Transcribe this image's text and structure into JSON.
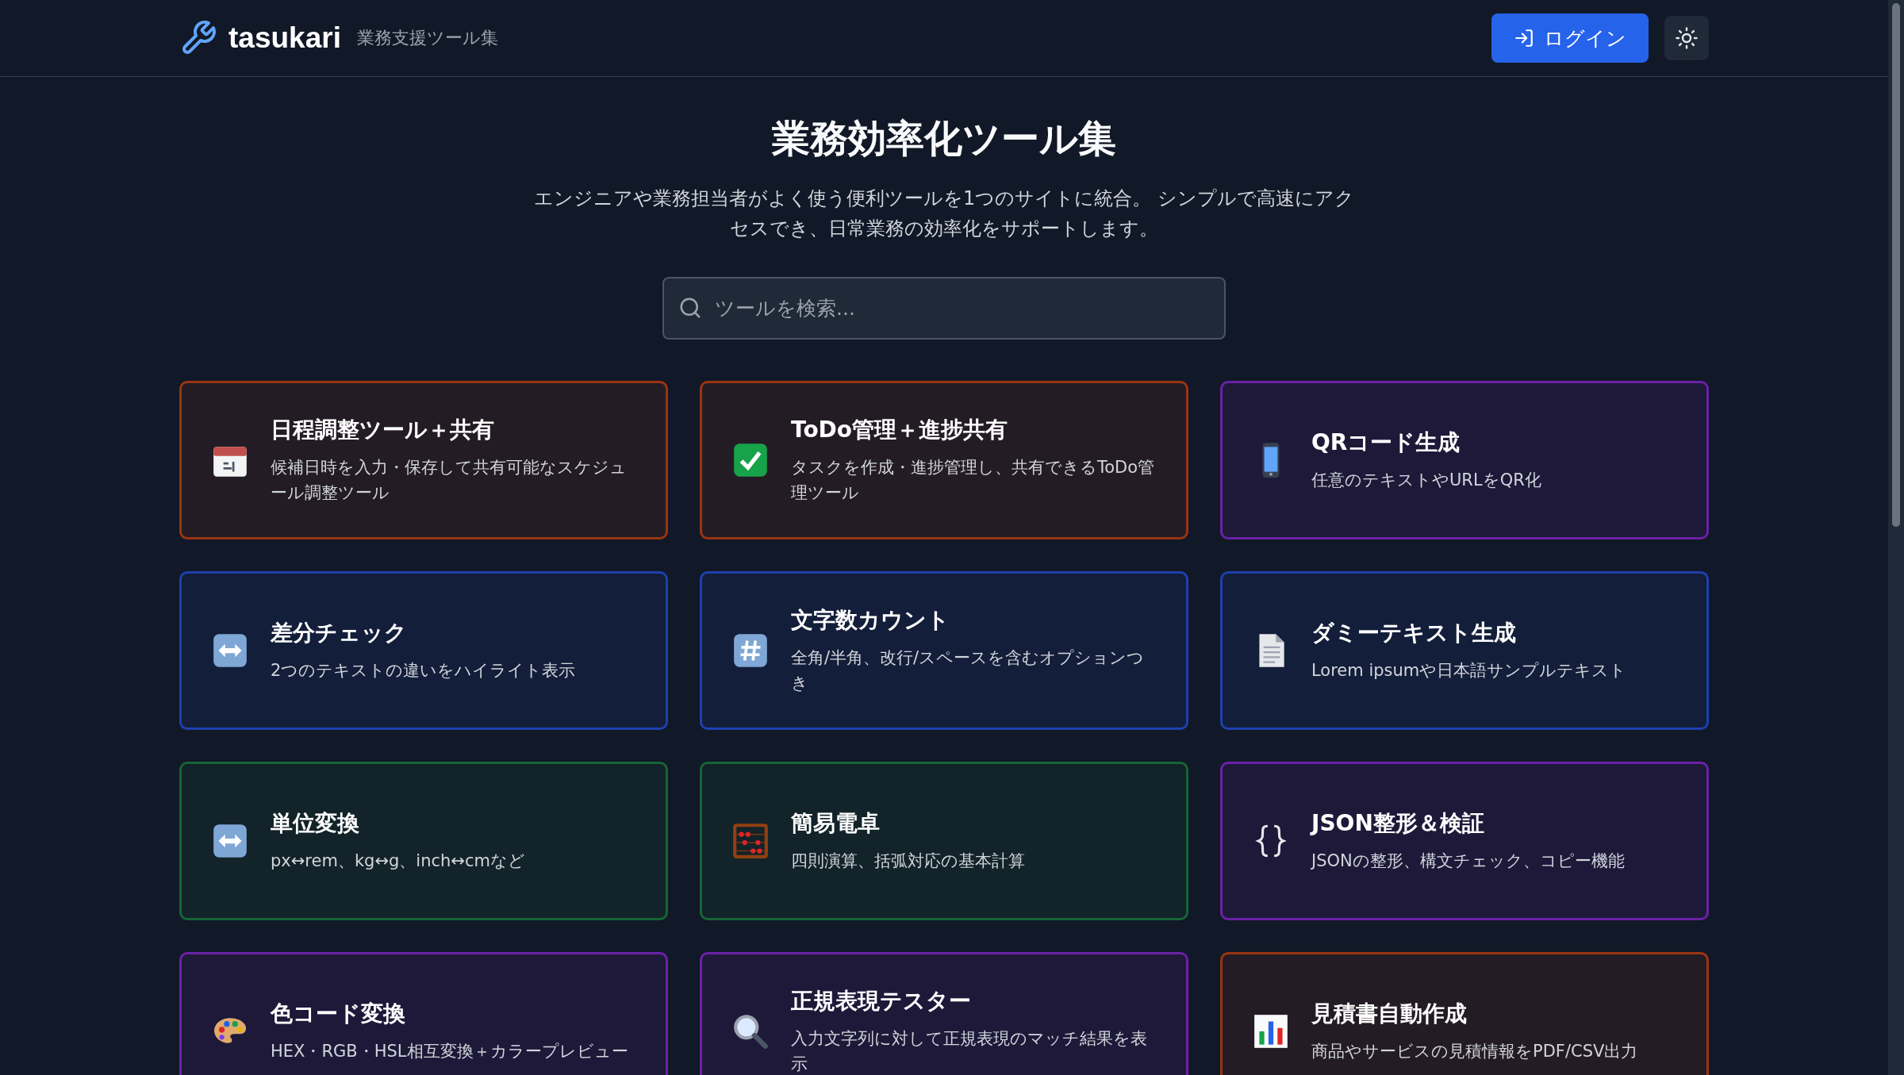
{
  "header": {
    "logo": "tasukari",
    "subtitle": "業務支援ツール集",
    "login_button": "ログイン"
  },
  "hero": {
    "title": "業務効率化ツール集",
    "description": "エンジニアや業務担当者がよく使う便利ツールを1つのサイトに統合。 シンプルで高速にアクセスでき、日常業務の効率化をサポートします。"
  },
  "search": {
    "placeholder": "ツールを検索..."
  },
  "tools": [
    {
      "title": "日程調整ツール＋共有",
      "description": "候補日時を入力・保存して共有可能なスケジュール調整ツール",
      "color": "#9a3412"
    },
    {
      "title": "ToDo管理＋進捗共有",
      "description": "タスクを作成・進捗管理し、共有できるToDo管理ツール",
      "color": "#9a3412"
    },
    {
      "title": "QRコード生成",
      "description": "任意のテキストやURLをQR化",
      "color": "#6b21a8"
    },
    {
      "title": "差分チェック",
      "description": "2つのテキストの違いをハイライト表示",
      "color": "#1e40af"
    },
    {
      "title": "文字数カウント",
      "description": "全角/半角、改行/スペースを含むオプションつき",
      "color": "#1e40af"
    },
    {
      "title": "ダミーテキスト生成",
      "description": "Lorem ipsumや日本語サンプルテキスト",
      "color": "#1e40af"
    },
    {
      "title": "単位変換",
      "description": "px↔rem、kg↔g、inch↔cmなど",
      "color": "#166534"
    },
    {
      "title": "簡易電卓",
      "description": "四則演算、括弧対応の基本計算",
      "color": "#166534"
    },
    {
      "title": "JSON整形＆検証",
      "description": "JSONの整形、構文チェック、コピー機能",
      "color": "#6b21a8"
    },
    {
      "title": "色コード変換",
      "description": "HEX・RGB・HSL相互変換＋カラープレビュー",
      "color": "#6b21a8"
    },
    {
      "title": "正規表現テスター",
      "description": "入力文字列に対して正規表現のマッチ結果を表示",
      "color": "#6b21a8"
    },
    {
      "title": "見積書自動作成",
      "description": "商品やサービスの見積情報をPDF/CSV出力",
      "color": "#9a3412"
    }
  ]
}
